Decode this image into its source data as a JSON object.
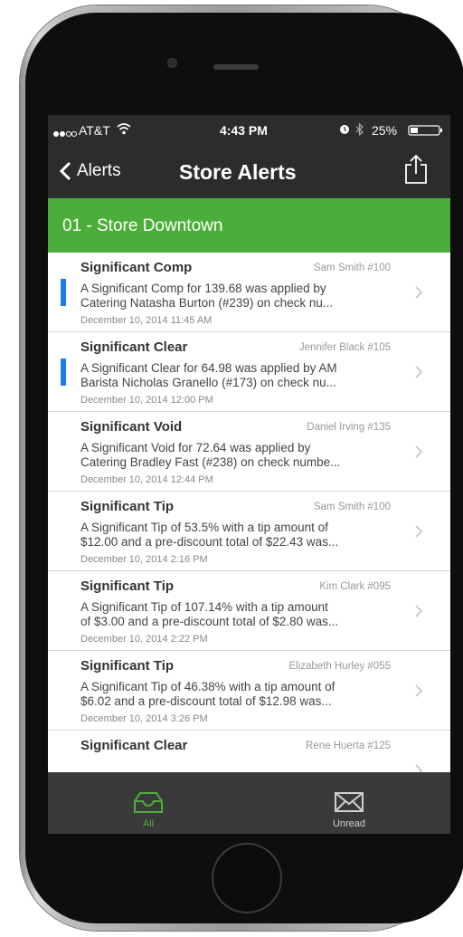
{
  "status_bar": {
    "carrier": "AT&T",
    "time": "4:43 PM",
    "battery": "25%"
  },
  "nav": {
    "back_label": "Alerts",
    "title": "Store Alerts"
  },
  "store_header": "01 - Store Downtown",
  "alerts": [
    {
      "title": "Significant Comp",
      "author": "Sam Smith #100",
      "line1": "A Significant Comp for 139.68 was applied by",
      "line2": "Catering  Natasha Burton (#239) on check nu...",
      "date": "December 10, 2014 11:45 AM",
      "unread": true
    },
    {
      "title": "Significant Clear",
      "author": "Jennifer Black #105",
      "line1": "A Significant Clear for 64.98 was applied by AM",
      "line2": "Barista  Nicholas Granello (#173) on check nu...",
      "date": "December 10, 2014 12:00 PM",
      "unread": true
    },
    {
      "title": "Significant Void",
      "author": "Daniel Irving #135",
      "line1": "A Significant Void for 72.64 was applied by",
      "line2": "Catering  Bradley Fast (#238) on check numbe...",
      "date": "December 10, 2014 12:44 PM",
      "unread": false
    },
    {
      "title": "Significant Tip",
      "author": "Sam Smith #100",
      "line1": "A Significant Tip of 53.5% with a tip amount of",
      "line2": "$12.00 and a pre-discount total of $22.43 was...",
      "date": "December 10, 2014 2:16 PM",
      "unread": false
    },
    {
      "title": "Significant Tip",
      "author": "Kim Clark #095",
      "line1": "A Significant Tip of 107.14% with a tip amount",
      "line2": "of $3.00 and a pre-discount total of $2.80 was...",
      "date": "December 10, 2014 2:22 PM",
      "unread": false
    },
    {
      "title": "Significant Tip",
      "author": "Elizabeth Hurley #055",
      "line1": "A Significant Tip of 46.38% with a tip amount of",
      "line2": "$6.02 and a pre-discount total of $12.98 was...",
      "date": "December 10, 2014 3:26 PM",
      "unread": false
    },
    {
      "title": "Significant Clear",
      "author": "Rene Huerta #125",
      "line1": "",
      "line2": "",
      "date": "",
      "unread": false
    }
  ],
  "tabs": [
    {
      "label": "All",
      "icon": "inbox-icon",
      "active": true
    },
    {
      "label": "Unread",
      "icon": "envelope-icon",
      "active": false
    }
  ],
  "colors": {
    "accent_green": "#4cae3a",
    "unread_blue": "#1f7ae8",
    "bar_dark": "#2c2c2c",
    "tab_active": "#4cae3a",
    "tab_inactive": "#d0d0d0"
  }
}
